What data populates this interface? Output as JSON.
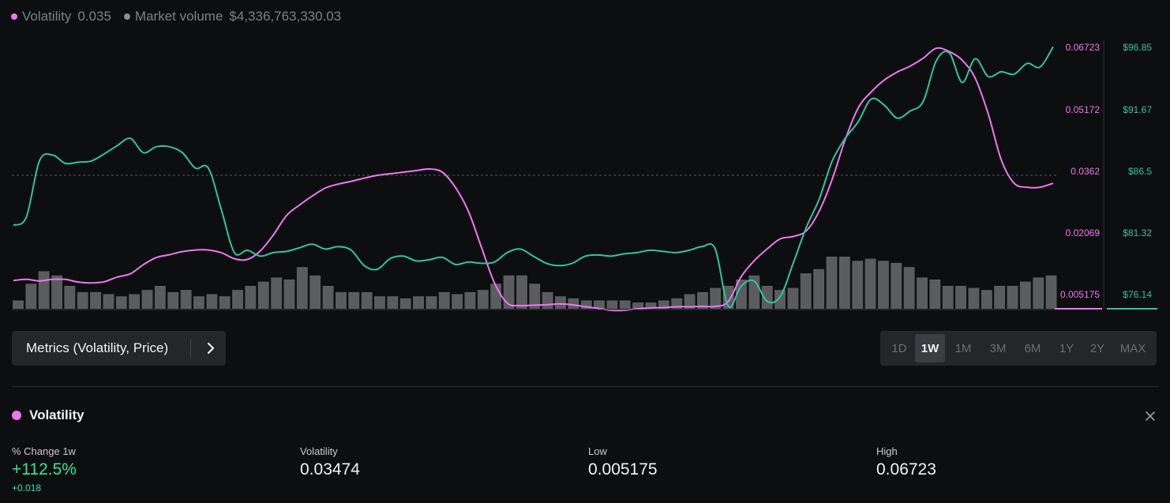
{
  "legend": {
    "volatility_label": "Volatility",
    "volatility_value": "0.035",
    "volume_label": "Market volume",
    "volume_value": "$4,336,763,330.03"
  },
  "colors": {
    "volatility": "#ef77ef",
    "price": "#2ec79b",
    "volume_dot": "#8a8d91",
    "volume_bar": "#5a5c60",
    "positive": "#2ee6a0"
  },
  "chart_data": {
    "type": "line",
    "series": [
      {
        "name": "Volatility",
        "axis": "left",
        "values": [
          0.0085,
          0.0088,
          0.0084,
          0.0088,
          0.0088,
          0.0081,
          0.0079,
          0.0082,
          0.0094,
          0.0102,
          0.0125,
          0.0143,
          0.015,
          0.0158,
          0.0162,
          0.0162,
          0.0155,
          0.014,
          0.0138,
          0.016,
          0.02,
          0.0248,
          0.0275,
          0.0298,
          0.0318,
          0.0328,
          0.0335,
          0.0343,
          0.035,
          0.0354,
          0.0358,
          0.0362,
          0.0366,
          0.0358,
          0.032,
          0.026,
          0.017,
          0.008,
          0.0028,
          0.0022,
          0.0023,
          0.0024,
          0.0026,
          0.0024,
          0.0019,
          0.0015,
          0.001,
          0.001,
          0.0014,
          0.0016,
          0.0017,
          0.0019,
          0.0019,
          0.002,
          0.002,
          0.0032,
          0.0095,
          0.0135,
          0.0165,
          0.019,
          0.0196,
          0.021,
          0.026,
          0.034,
          0.044,
          0.052,
          0.056,
          0.059,
          0.061,
          0.0625,
          0.0645,
          0.067,
          0.0662,
          0.064,
          0.0595,
          0.0505,
          0.039,
          0.033,
          0.032,
          0.032,
          0.033
        ]
      },
      {
        "name": "Price",
        "axis": "right",
        "values": [
          81.9,
          82.6,
          87.3,
          87.8,
          87.1,
          87.2,
          87.3,
          87.9,
          88.6,
          89.2,
          88.0,
          88.5,
          88.5,
          88.0,
          86.7,
          86.7,
          83.2,
          79.6,
          79.8,
          79.3,
          79.6,
          79.7,
          80.0,
          80.3,
          79.9,
          80.1,
          79.8,
          78.5,
          78.2,
          79.1,
          79.3,
          78.9,
          79.0,
          79.2,
          78.6,
          78.8,
          78.7,
          78.8,
          79.6,
          79.9,
          79.3,
          78.7,
          78.5,
          78.7,
          79.3,
          79.4,
          79.3,
          79.5,
          79.6,
          79.8,
          79.7,
          79.6,
          79.8,
          80.1,
          79.9,
          75.1,
          76.8,
          77.2,
          75.5,
          75.9,
          78.7,
          81.7,
          84.1,
          87.3,
          89.2,
          90.6,
          92.5,
          92.0,
          90.9,
          91.5,
          92.3,
          95.7,
          96.4,
          93.9,
          95.9,
          94.4,
          94.8,
          94.6,
          95.5,
          95.2,
          96.9
        ]
      }
    ],
    "volume": [
      4,
      12,
      18,
      16,
      11,
      8,
      8,
      7,
      6,
      7,
      9,
      11,
      8,
      9,
      6,
      7,
      6,
      9,
      11,
      13,
      15,
      14,
      20,
      16,
      11,
      8,
      8,
      8,
      6,
      6,
      5,
      6,
      6,
      8,
      7,
      8,
      9,
      12,
      16,
      16,
      12,
      8,
      6,
      5,
      4,
      4,
      4,
      4,
      3,
      3,
      4,
      5,
      7,
      8,
      10,
      11,
      14,
      16,
      11,
      9,
      10,
      17,
      19,
      25,
      25,
      23,
      24,
      23,
      22,
      20,
      15,
      14,
      11,
      11,
      10,
      9,
      11,
      11,
      13,
      15,
      16
    ]
  },
  "y_axis_left": [
    "0.06723",
    "0.05172",
    "0.0362",
    "0.02069",
    "0.005175"
  ],
  "y_axis_right": [
    "$96.85",
    "$91.67",
    "$86.5",
    "$81.32",
    "$76.14"
  ],
  "metrics_button": {
    "label": "Metrics (Volatility, Price)"
  },
  "time_ranges": [
    "1D",
    "1W",
    "1M",
    "3M",
    "6M",
    "1Y",
    "2Y",
    "MAX"
  ],
  "selected_range": "1W",
  "section": {
    "title": "Volatility",
    "stats": [
      {
        "label": "% Change 1w",
        "value": "+112.5%",
        "sub": "+0.018"
      },
      {
        "label": "Volatility",
        "value": "0.03474"
      },
      {
        "label": "Low",
        "value": "0.005175"
      },
      {
        "label": "High",
        "value": "0.06723"
      }
    ]
  }
}
